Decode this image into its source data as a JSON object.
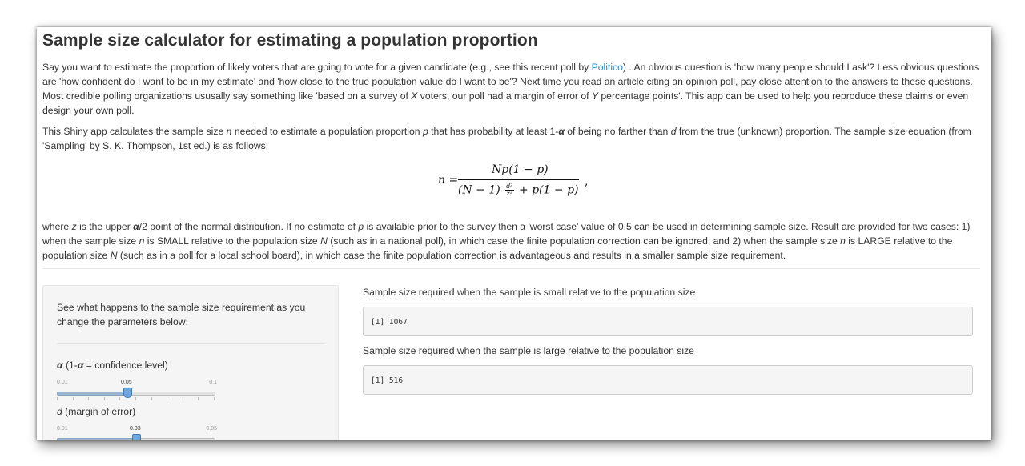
{
  "title": "Sample size calculator for estimating a population proportion",
  "intro": {
    "part1": "Say you want to estimate the proportion of likely voters that are going to vote for a given candidate (e.g., see this recent poll by ",
    "link": "Politico",
    "part2": ") . An obvious question is 'how many people should I ask'? Less obvious questions are 'how confident do I want to be in my estimate' and 'how close to the true population value do I want to be'? Next time you read an article citing an opinion poll, pay close attention to the answers to these questions. Most credible polling organizations ususally say something like 'based on a survey of ",
    "xvar": "X",
    "part3": " voters, our poll had a margin of error of ",
    "yvar": "Y",
    "part4": " percentage points'. This app can be used to help you reproduce these claims or even design your own poll."
  },
  "description": {
    "a": "This Shiny app calculates the sample size ",
    "n": "n",
    "b": " needed to estimate a population proportion ",
    "p": "p",
    "c": " that has probability at least 1-",
    "alpha": "α",
    "d": " of being no farther than ",
    "dvar": "d",
    "e": " from the true (unknown) proportion. The sample size equation (from 'Sampling' by S. K. Thompson, 1st ed.) is as follows:"
  },
  "formula": {
    "lhs": "n =",
    "numerator": "Np(1 − p)",
    "denominator_left": "(N − 1)",
    "d2": "d²",
    "z2": "z²",
    "denominator_right": "+ p(1 − p)",
    "trailing": ","
  },
  "details": {
    "a": "where ",
    "z": "z",
    "b": " is the upper ",
    "alpha2": "α",
    "c": "/2 point of the normal distribution. If no estimate of ",
    "p": "p",
    "d": " is available prior to the survey then a 'worst case' value of 0.5 can be used in determining sample size. Result are provided for two cases: 1) when the sample size ",
    "n1": "n",
    "e": " is SMALL relative to the population size ",
    "N1": "N",
    "f": " (such as in a national poll), in which case the finite population correction can be ignored; and 2) when the sample size ",
    "n2": "n",
    "g": " is LARGE relative to the population size ",
    "N2": "N",
    "h": " (such as in a poll for a local school board), in which case the finite population correction is advantageous and results in a smaller sample size requirement."
  },
  "sidebar": {
    "intro": "See what happens to the sample size requirement as you change the parameters below:",
    "alpha_slider": {
      "symbol": "α",
      "label_a": " (1-",
      "symbol2": "α",
      "label_b": " = confidence level)",
      "min": "0.01",
      "max": "0.1",
      "value": "0.05",
      "fraction": 0.444
    },
    "d_slider": {
      "symbol": "d",
      "label": " (margin of error)",
      "min": "0.01",
      "max": "0.05",
      "value": "0.03",
      "fraction": 0.5
    }
  },
  "outputs": {
    "small_label": "Sample size required when the sample is small relative to the population size",
    "small_value": "[1] 1067",
    "large_label": "Sample size required when the sample is large relative to the population size",
    "large_value": "[1] 516"
  },
  "colors": {
    "link": "#2a8bc9",
    "handle": "#6ea6dd"
  }
}
